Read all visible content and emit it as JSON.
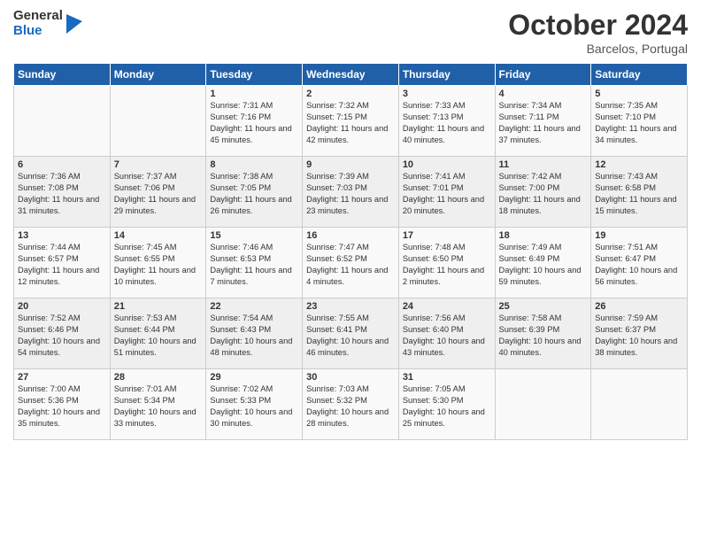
{
  "header": {
    "logo_general": "General",
    "logo_blue": "Blue",
    "month": "October 2024",
    "location": "Barcelos, Portugal"
  },
  "days_of_week": [
    "Sunday",
    "Monday",
    "Tuesday",
    "Wednesday",
    "Thursday",
    "Friday",
    "Saturday"
  ],
  "weeks": [
    [
      {
        "day": "",
        "sunrise": "",
        "sunset": "",
        "daylight": ""
      },
      {
        "day": "",
        "sunrise": "",
        "sunset": "",
        "daylight": ""
      },
      {
        "day": "1",
        "sunrise": "Sunrise: 7:31 AM",
        "sunset": "Sunset: 7:16 PM",
        "daylight": "Daylight: 11 hours and 45 minutes."
      },
      {
        "day": "2",
        "sunrise": "Sunrise: 7:32 AM",
        "sunset": "Sunset: 7:15 PM",
        "daylight": "Daylight: 11 hours and 42 minutes."
      },
      {
        "day": "3",
        "sunrise": "Sunrise: 7:33 AM",
        "sunset": "Sunset: 7:13 PM",
        "daylight": "Daylight: 11 hours and 40 minutes."
      },
      {
        "day": "4",
        "sunrise": "Sunrise: 7:34 AM",
        "sunset": "Sunset: 7:11 PM",
        "daylight": "Daylight: 11 hours and 37 minutes."
      },
      {
        "day": "5",
        "sunrise": "Sunrise: 7:35 AM",
        "sunset": "Sunset: 7:10 PM",
        "daylight": "Daylight: 11 hours and 34 minutes."
      }
    ],
    [
      {
        "day": "6",
        "sunrise": "Sunrise: 7:36 AM",
        "sunset": "Sunset: 7:08 PM",
        "daylight": "Daylight: 11 hours and 31 minutes."
      },
      {
        "day": "7",
        "sunrise": "Sunrise: 7:37 AM",
        "sunset": "Sunset: 7:06 PM",
        "daylight": "Daylight: 11 hours and 29 minutes."
      },
      {
        "day": "8",
        "sunrise": "Sunrise: 7:38 AM",
        "sunset": "Sunset: 7:05 PM",
        "daylight": "Daylight: 11 hours and 26 minutes."
      },
      {
        "day": "9",
        "sunrise": "Sunrise: 7:39 AM",
        "sunset": "Sunset: 7:03 PM",
        "daylight": "Daylight: 11 hours and 23 minutes."
      },
      {
        "day": "10",
        "sunrise": "Sunrise: 7:41 AM",
        "sunset": "Sunset: 7:01 PM",
        "daylight": "Daylight: 11 hours and 20 minutes."
      },
      {
        "day": "11",
        "sunrise": "Sunrise: 7:42 AM",
        "sunset": "Sunset: 7:00 PM",
        "daylight": "Daylight: 11 hours and 18 minutes."
      },
      {
        "day": "12",
        "sunrise": "Sunrise: 7:43 AM",
        "sunset": "Sunset: 6:58 PM",
        "daylight": "Daylight: 11 hours and 15 minutes."
      }
    ],
    [
      {
        "day": "13",
        "sunrise": "Sunrise: 7:44 AM",
        "sunset": "Sunset: 6:57 PM",
        "daylight": "Daylight: 11 hours and 12 minutes."
      },
      {
        "day": "14",
        "sunrise": "Sunrise: 7:45 AM",
        "sunset": "Sunset: 6:55 PM",
        "daylight": "Daylight: 11 hours and 10 minutes."
      },
      {
        "day": "15",
        "sunrise": "Sunrise: 7:46 AM",
        "sunset": "Sunset: 6:53 PM",
        "daylight": "Daylight: 11 hours and 7 minutes."
      },
      {
        "day": "16",
        "sunrise": "Sunrise: 7:47 AM",
        "sunset": "Sunset: 6:52 PM",
        "daylight": "Daylight: 11 hours and 4 minutes."
      },
      {
        "day": "17",
        "sunrise": "Sunrise: 7:48 AM",
        "sunset": "Sunset: 6:50 PM",
        "daylight": "Daylight: 11 hours and 2 minutes."
      },
      {
        "day": "18",
        "sunrise": "Sunrise: 7:49 AM",
        "sunset": "Sunset: 6:49 PM",
        "daylight": "Daylight: 10 hours and 59 minutes."
      },
      {
        "day": "19",
        "sunrise": "Sunrise: 7:51 AM",
        "sunset": "Sunset: 6:47 PM",
        "daylight": "Daylight: 10 hours and 56 minutes."
      }
    ],
    [
      {
        "day": "20",
        "sunrise": "Sunrise: 7:52 AM",
        "sunset": "Sunset: 6:46 PM",
        "daylight": "Daylight: 10 hours and 54 minutes."
      },
      {
        "day": "21",
        "sunrise": "Sunrise: 7:53 AM",
        "sunset": "Sunset: 6:44 PM",
        "daylight": "Daylight: 10 hours and 51 minutes."
      },
      {
        "day": "22",
        "sunrise": "Sunrise: 7:54 AM",
        "sunset": "Sunset: 6:43 PM",
        "daylight": "Daylight: 10 hours and 48 minutes."
      },
      {
        "day": "23",
        "sunrise": "Sunrise: 7:55 AM",
        "sunset": "Sunset: 6:41 PM",
        "daylight": "Daylight: 10 hours and 46 minutes."
      },
      {
        "day": "24",
        "sunrise": "Sunrise: 7:56 AM",
        "sunset": "Sunset: 6:40 PM",
        "daylight": "Daylight: 10 hours and 43 minutes."
      },
      {
        "day": "25",
        "sunrise": "Sunrise: 7:58 AM",
        "sunset": "Sunset: 6:39 PM",
        "daylight": "Daylight: 10 hours and 40 minutes."
      },
      {
        "day": "26",
        "sunrise": "Sunrise: 7:59 AM",
        "sunset": "Sunset: 6:37 PM",
        "daylight": "Daylight: 10 hours and 38 minutes."
      }
    ],
    [
      {
        "day": "27",
        "sunrise": "Sunrise: 7:00 AM",
        "sunset": "Sunset: 5:36 PM",
        "daylight": "Daylight: 10 hours and 35 minutes."
      },
      {
        "day": "28",
        "sunrise": "Sunrise: 7:01 AM",
        "sunset": "Sunset: 5:34 PM",
        "daylight": "Daylight: 10 hours and 33 minutes."
      },
      {
        "day": "29",
        "sunrise": "Sunrise: 7:02 AM",
        "sunset": "Sunset: 5:33 PM",
        "daylight": "Daylight: 10 hours and 30 minutes."
      },
      {
        "day": "30",
        "sunrise": "Sunrise: 7:03 AM",
        "sunset": "Sunset: 5:32 PM",
        "daylight": "Daylight: 10 hours and 28 minutes."
      },
      {
        "day": "31",
        "sunrise": "Sunrise: 7:05 AM",
        "sunset": "Sunset: 5:30 PM",
        "daylight": "Daylight: 10 hours and 25 minutes."
      },
      {
        "day": "",
        "sunrise": "",
        "sunset": "",
        "daylight": ""
      },
      {
        "day": "",
        "sunrise": "",
        "sunset": "",
        "daylight": ""
      }
    ]
  ]
}
